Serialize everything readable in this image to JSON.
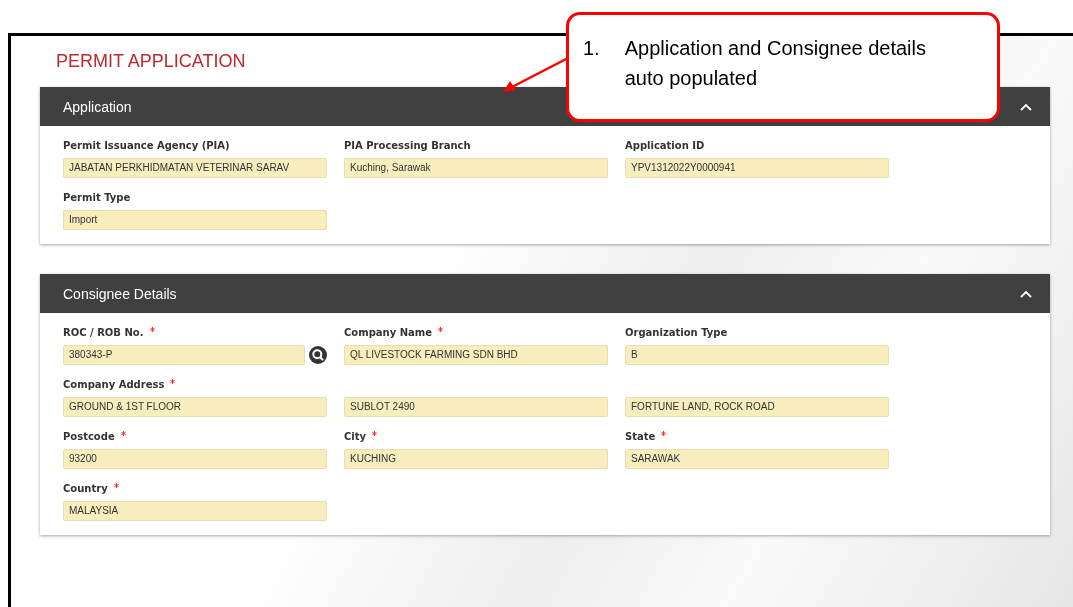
{
  "page_title": "PERMIT APPLICATION",
  "sections": [
    {
      "title": "Application",
      "expanded": true,
      "rows": [
        [
          {
            "label": "Permit Issuance Agency (PIA)",
            "required": false,
            "value": "JABATAN PERKHIDMATAN VETERINAR SARAV",
            "kind": "text"
          },
          {
            "label": "PIA Processing Branch",
            "required": false,
            "value": "Kuching, Sarawak",
            "kind": "text"
          },
          {
            "label": "Application ID",
            "required": false,
            "value": "YPV1312022Y0000941",
            "kind": "text"
          }
        ],
        [
          {
            "label": "Permit Type",
            "required": false,
            "value": "Import",
            "kind": "text"
          }
        ]
      ]
    },
    {
      "title": "Consignee Details",
      "expanded": true,
      "rows": [
        [
          {
            "label": "ROC / ROB No.",
            "required": true,
            "value": "380343-P",
            "kind": "lookup"
          },
          {
            "label": "Company Name",
            "required": true,
            "value": "QL LIVESTOCK FARMING SDN BHD",
            "kind": "text"
          },
          {
            "label": "Organization Type",
            "required": false,
            "value": "B",
            "kind": "text"
          }
        ],
        [
          {
            "label": "Company Address",
            "required": true,
            "value": "GROUND & 1ST FLOOR",
            "kind": "text"
          },
          {
            "value": "SUBLOT 2490",
            "kind": "text"
          },
          {
            "value": "FORTUNE LAND, ROCK ROAD",
            "kind": "text"
          }
        ],
        [
          {
            "label": "Postcode",
            "required": true,
            "value": "93200",
            "kind": "text"
          },
          {
            "label": "City",
            "required": true,
            "value": "KUCHING",
            "kind": "text"
          },
          {
            "label": "State",
            "required": true,
            "value": "SARAWAK",
            "kind": "text"
          }
        ],
        [
          {
            "label": "Country",
            "required": true,
            "value": "MALAYSIA",
            "kind": "text"
          }
        ]
      ]
    }
  ],
  "callout": {
    "number": "1.",
    "text": "Application and Consignee details auto populated"
  }
}
